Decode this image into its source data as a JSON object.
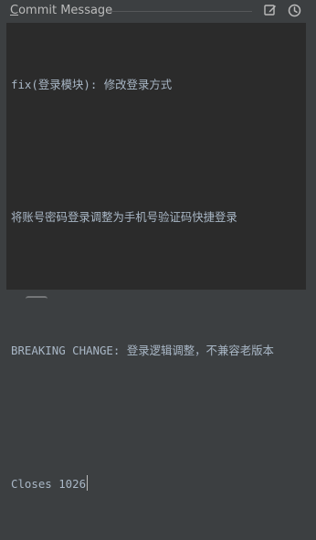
{
  "header": {
    "title_first_letter": "C",
    "title_rest": "ommit Message",
    "icons": {
      "edit": "edit-message-icon",
      "history": "message-history-icon"
    }
  },
  "editor": {
    "lines": [
      "fix(登录模块): 修改登录方式",
      "",
      "将账号密码登录调整为手机号验证码快捷登录",
      "",
      "BREAKING CHANGE: 登录逻辑调整，不兼容老版本",
      "",
      "Closes 1026"
    ]
  },
  "colors": {
    "panel_bg": "#3c3f41",
    "editor_bg": "#2b2b2b",
    "text": "#a9b7c6",
    "title": "#bbbbbb"
  }
}
